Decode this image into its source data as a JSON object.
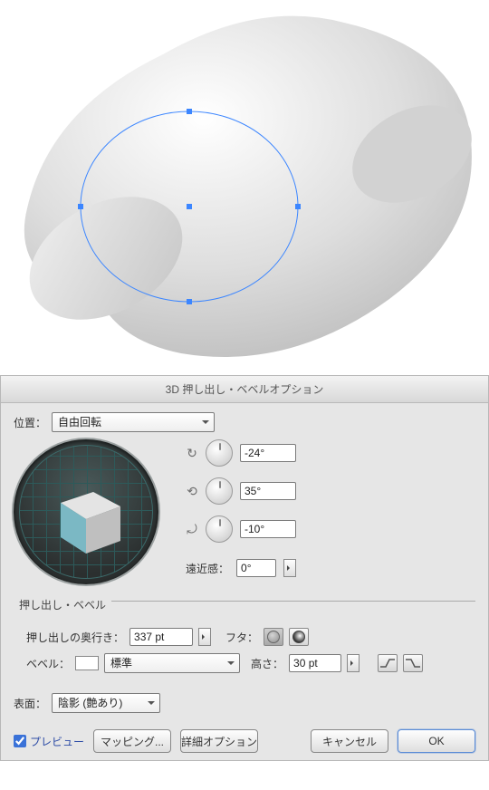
{
  "dialog": {
    "title": "3D 押し出し・ベベルオプション",
    "position_label": "位置：",
    "position_value": "自由回転",
    "rotations": {
      "x": "-24°",
      "y": "35°",
      "z": "-10°"
    },
    "perspective_label": "遠近感：",
    "perspective_value": "0°"
  },
  "extrude": {
    "group_label": "押し出し・ベベル",
    "depth_label": "押し出しの奥行き：",
    "depth_value": "337 pt",
    "cap_label": "フタ：",
    "bevel_label": "ベベル：",
    "bevel_value": "標準",
    "height_label": "高さ：",
    "height_value": "30 pt"
  },
  "surface": {
    "label": "表面：",
    "value": "陰影 (艶あり)"
  },
  "footer": {
    "preview": "プレビュー",
    "map_art": "マッピング...",
    "more": "詳細オプション",
    "cancel": "キャンセル",
    "ok": "OK"
  }
}
